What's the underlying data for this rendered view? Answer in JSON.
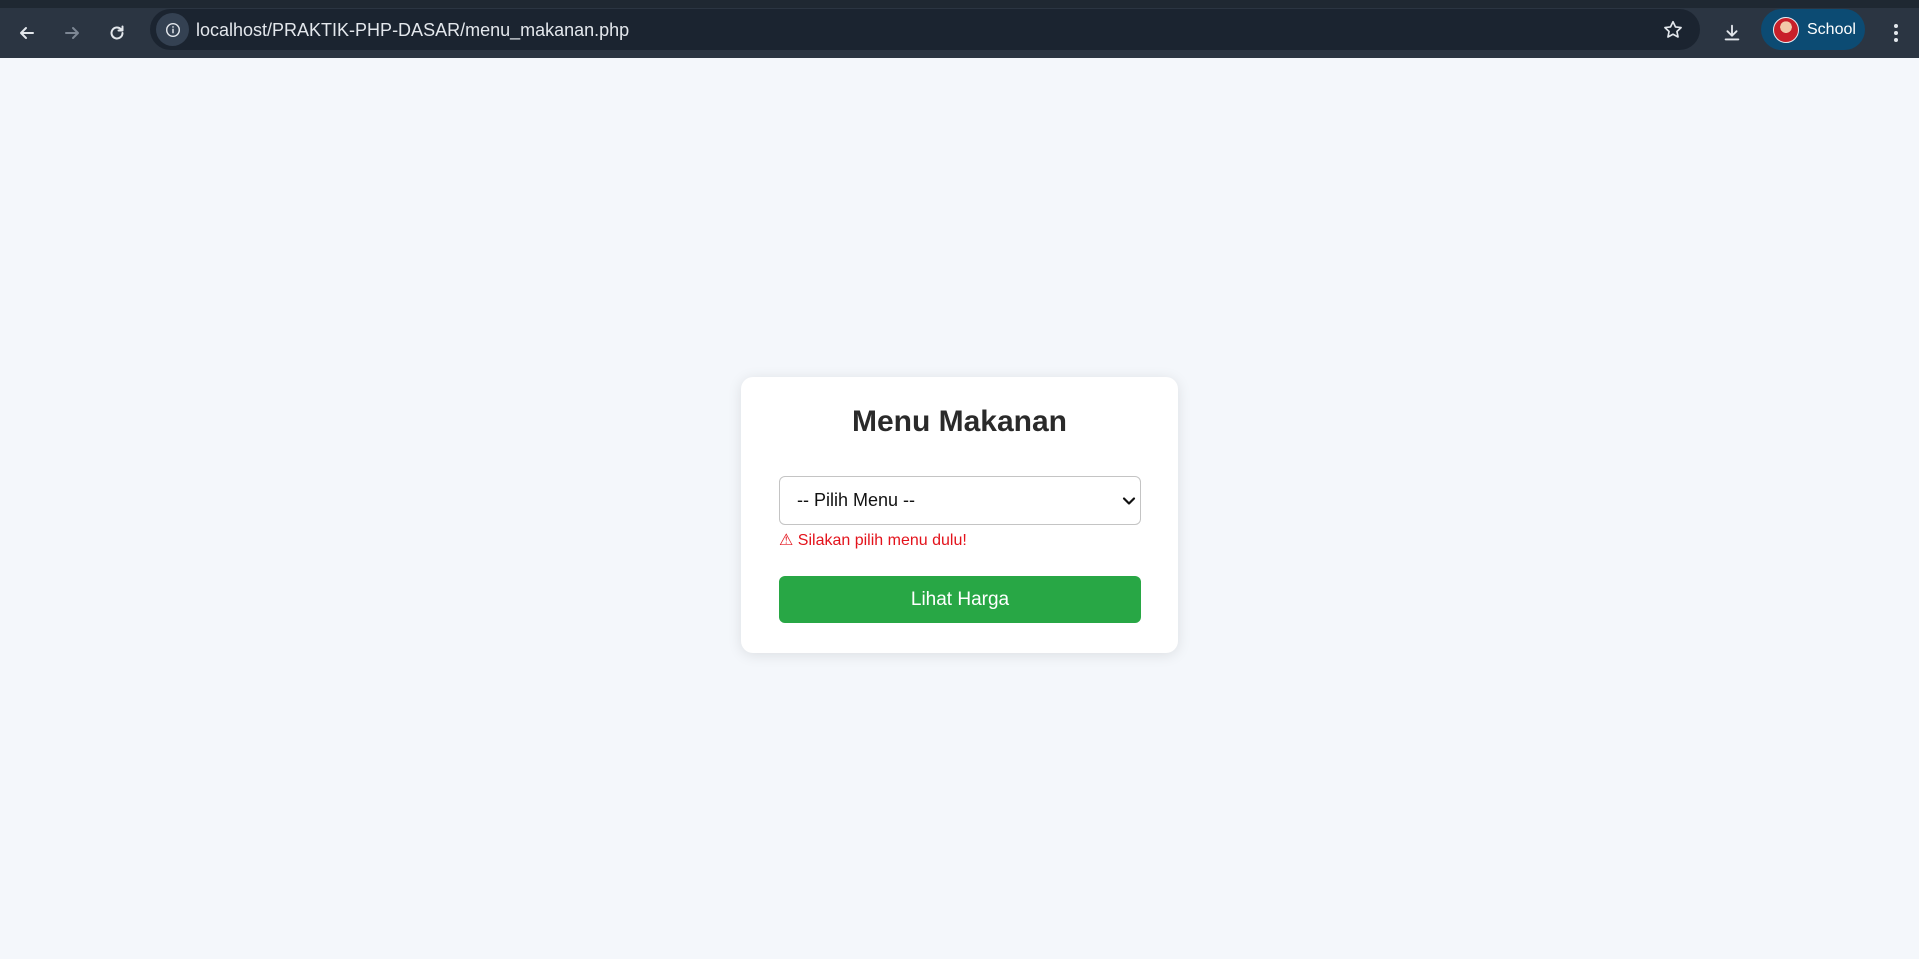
{
  "browser": {
    "url": "localhost/PRAKTIK-PHP-DASAR/menu_makanan.php",
    "profile_label": "School",
    "accent_color": "#0c4b73"
  },
  "form": {
    "title": "Menu Makanan",
    "select_value": "-- Pilih Menu --",
    "error_icon": "⚠",
    "error_text": "Silakan pilih menu dulu!",
    "submit_label": "Lihat Harga",
    "submit_color": "#28a745",
    "error_color": "#e3121b"
  }
}
